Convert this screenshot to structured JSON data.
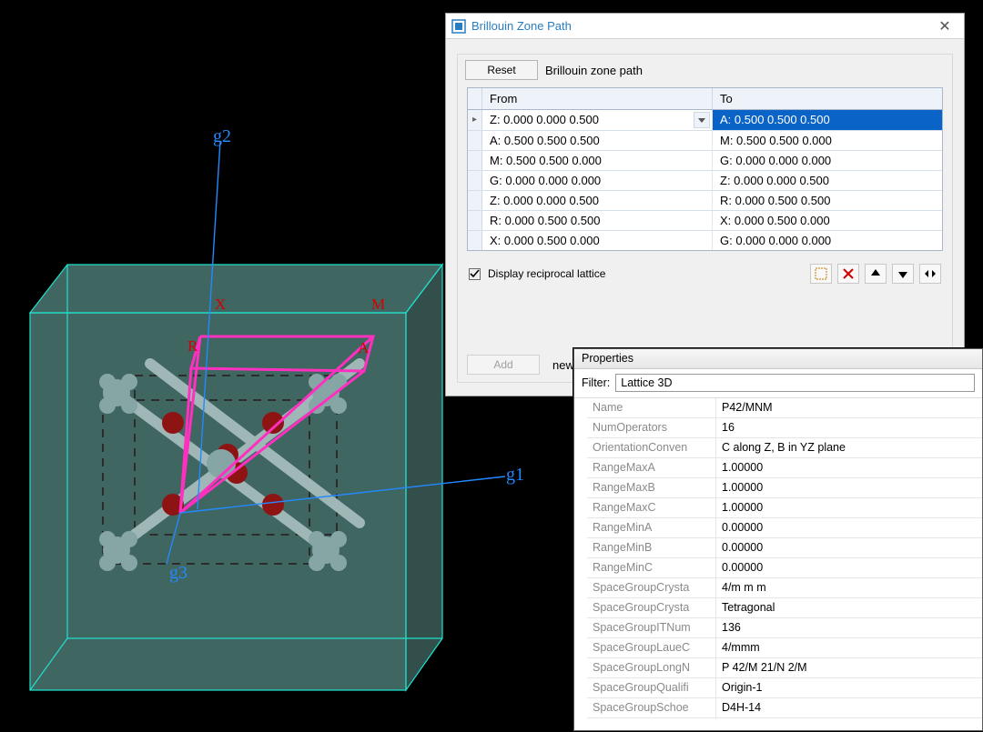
{
  "viewport": {
    "axis_labels": {
      "g1": "g1",
      "g2": "g2",
      "g3": "g3"
    },
    "point_labels": {
      "X": "X",
      "M": "M",
      "R": "R",
      "A": "A"
    }
  },
  "bz_dialog": {
    "title": "Brillouin Zone Path",
    "reset_btn": "Reset",
    "path_note": "Brillouin zone path",
    "columns": {
      "from": "From",
      "to": "To"
    },
    "rows": [
      {
        "from": "Z:  0.000  0.000  0.500",
        "to": "A:  0.500  0.500  0.500",
        "selected": true,
        "current": true
      },
      {
        "from": "A:  0.500  0.500  0.500",
        "to": "M:  0.500  0.500  0.000"
      },
      {
        "from": "M:  0.500  0.500  0.000",
        "to": "G:  0.000  0.000  0.000"
      },
      {
        "from": "G:  0.000  0.000  0.000",
        "to": "Z:  0.000  0.000  0.500"
      },
      {
        "from": "Z:  0.000  0.000  0.500",
        "to": "R:  0.000  0.500  0.500"
      },
      {
        "from": "R:  0.000  0.500  0.500",
        "to": "X:  0.000  0.500  0.000"
      },
      {
        "from": "X:  0.000  0.500  0.000",
        "to": "G:  0.000  0.000  0.000"
      }
    ],
    "display_reciprocal": "Display reciprocal lattice",
    "add_btn": "Add",
    "add_note": "new",
    "icons": [
      "select-rect-icon",
      "delete-icon",
      "move-up-icon",
      "move-down-icon",
      "move-horiz-icon"
    ]
  },
  "properties": {
    "title": "Properties",
    "filter_label": "Filter:",
    "filter_value": "Lattice 3D",
    "rows": [
      {
        "name": "Name",
        "value": "P42/MNM"
      },
      {
        "name": "NumOperators",
        "value": "16"
      },
      {
        "name": "OrientationConven",
        "value": "C along Z, B in YZ plane"
      },
      {
        "name": "RangeMaxA",
        "value": "1.00000"
      },
      {
        "name": "RangeMaxB",
        "value": "1.00000"
      },
      {
        "name": "RangeMaxC",
        "value": "1.00000"
      },
      {
        "name": "RangeMinA",
        "value": "0.00000"
      },
      {
        "name": "RangeMinB",
        "value": "0.00000"
      },
      {
        "name": "RangeMinC",
        "value": "0.00000"
      },
      {
        "name": "SpaceGroupCrysta",
        "value": "4/m m m"
      },
      {
        "name": "SpaceGroupCrysta",
        "value": "Tetragonal"
      },
      {
        "name": "SpaceGroupITNum",
        "value": "136"
      },
      {
        "name": "SpaceGroupLaueC",
        "value": "4/mmm"
      },
      {
        "name": "SpaceGroupLongN",
        "value": "P 42/M 21/N 2/M"
      },
      {
        "name": "SpaceGroupQualifi",
        "value": "Origin-1"
      },
      {
        "name": "SpaceGroupSchoe",
        "value": "D4H-14"
      }
    ]
  }
}
